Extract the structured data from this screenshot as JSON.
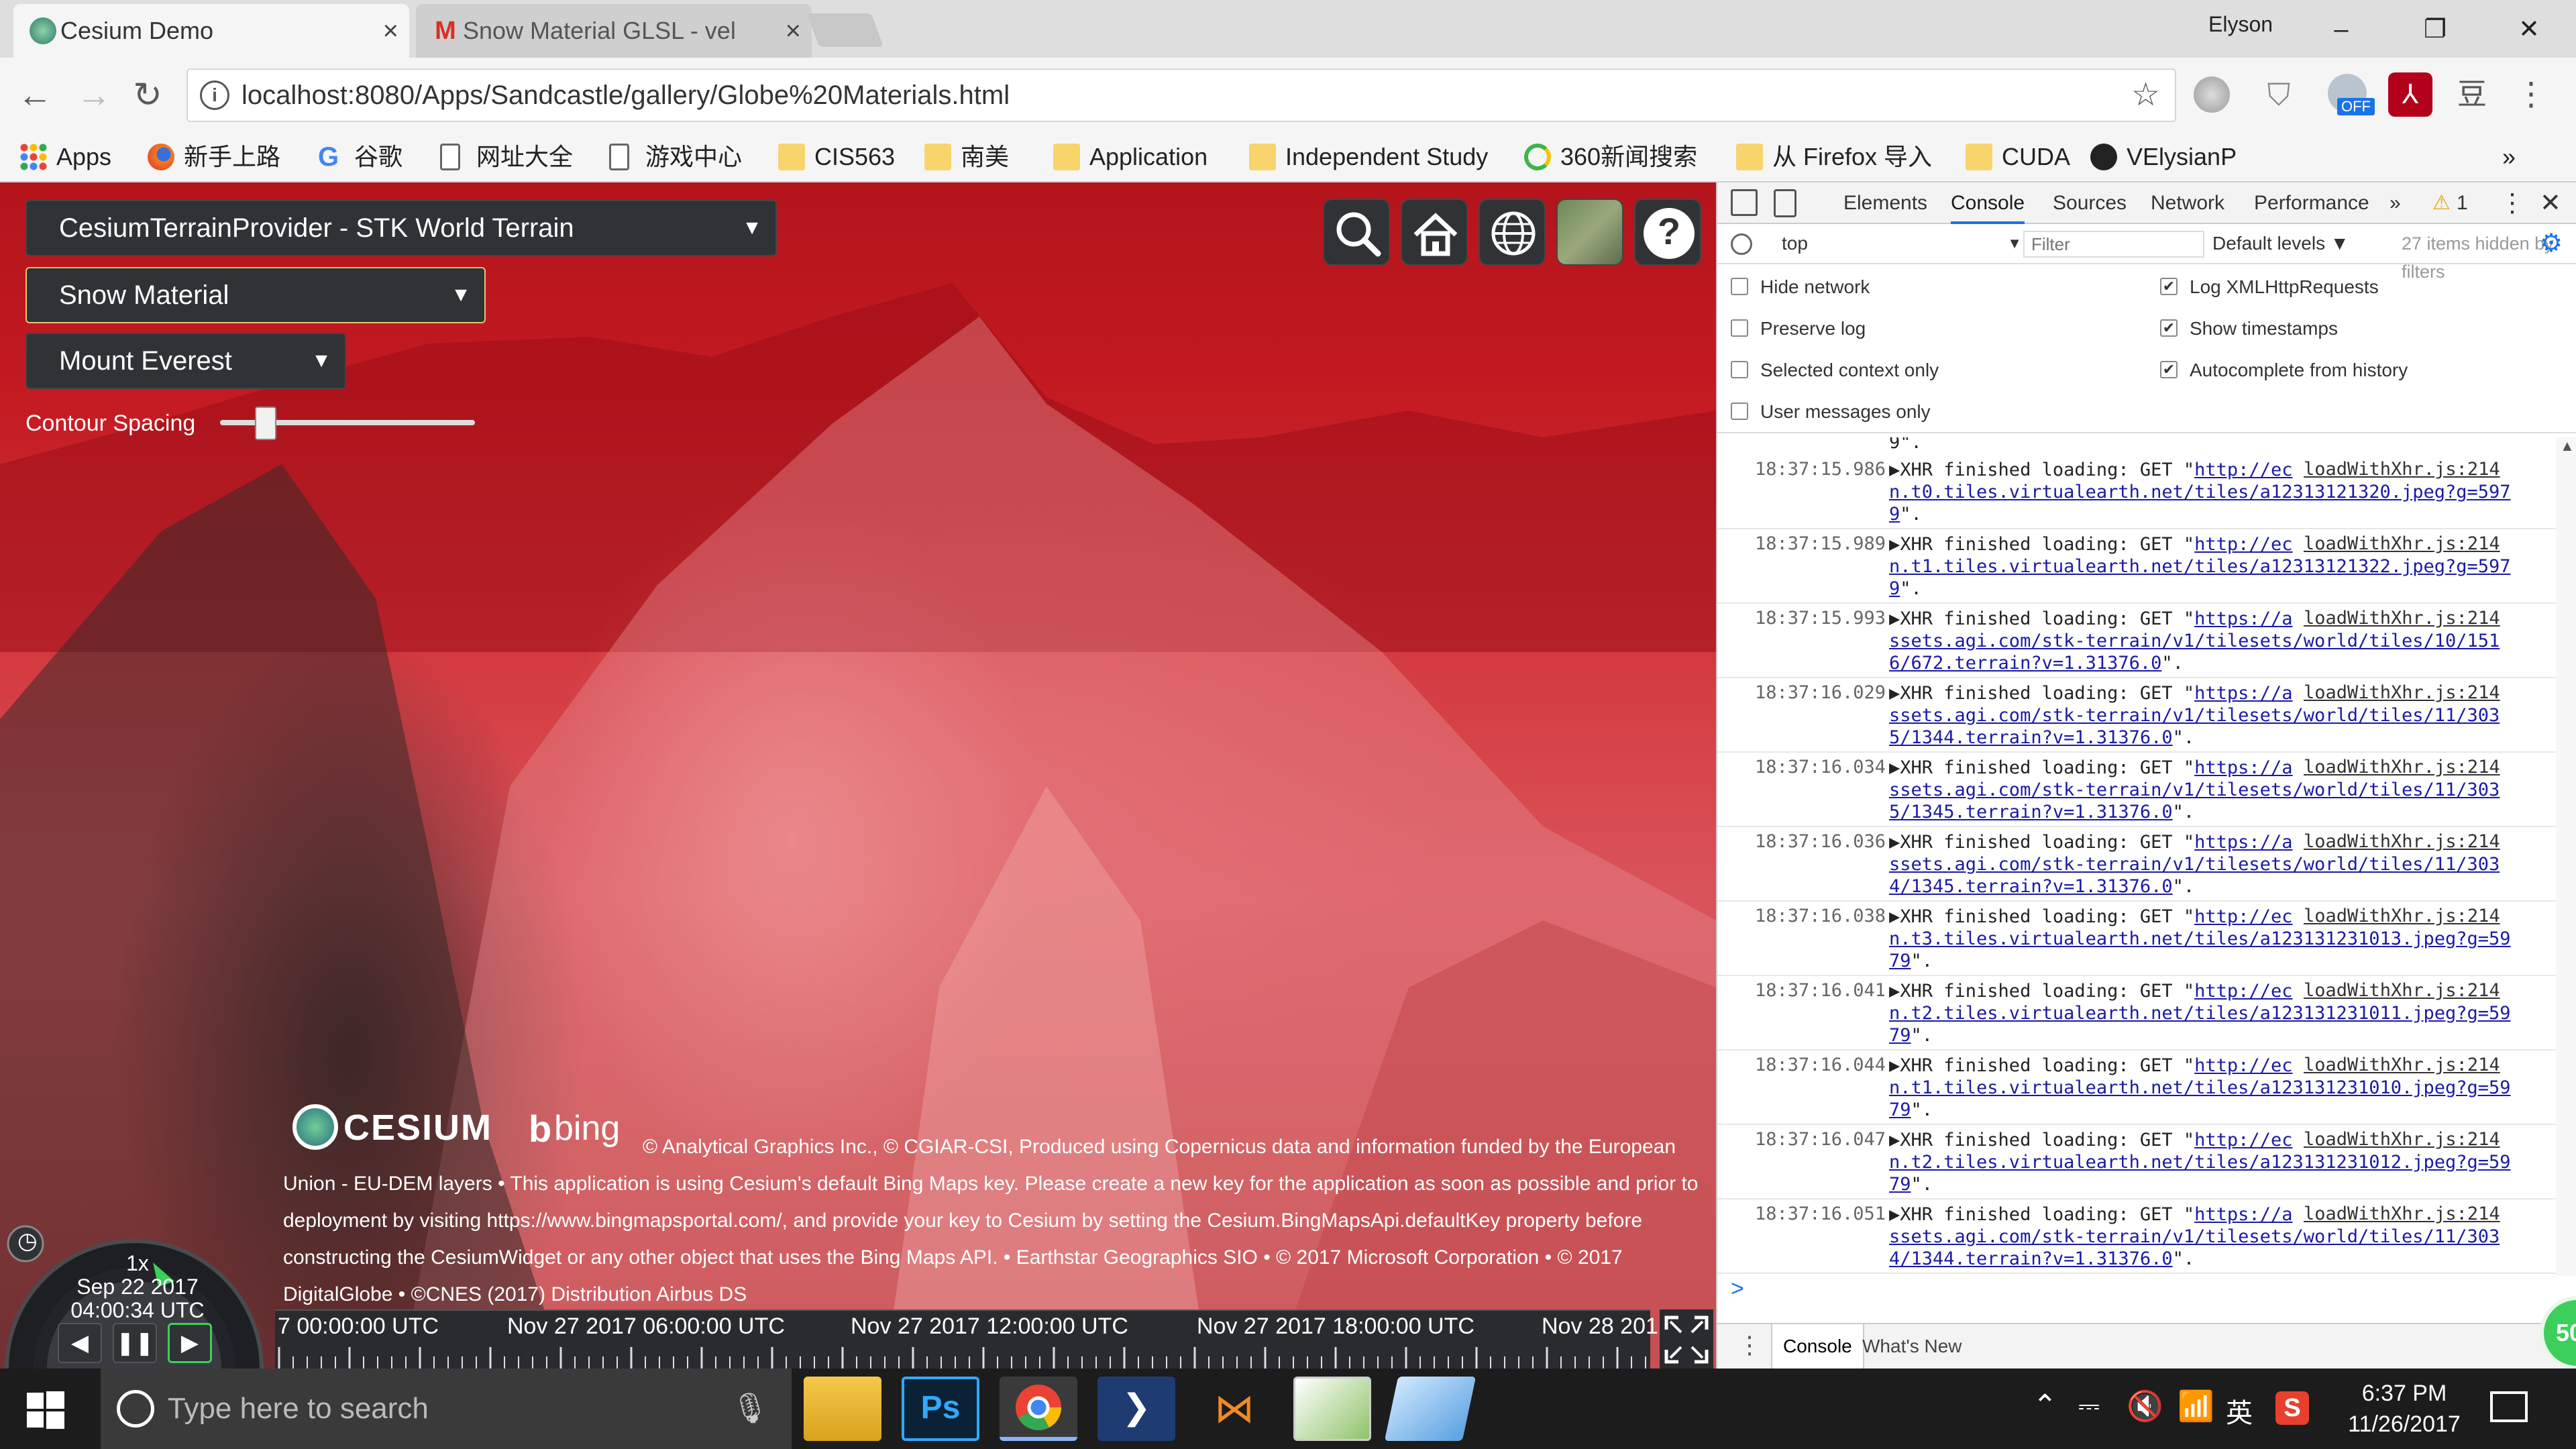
{
  "browser": {
    "tabs": [
      {
        "title": "Cesium Demo",
        "close": "×"
      },
      {
        "title": "Snow Material GLSL - vel",
        "close": "×"
      }
    ],
    "profile_name": "Elyson",
    "window_buttons": {
      "minimize": "–",
      "restore": "❐",
      "close": "✕"
    },
    "url": "localhost:8080/Apps/Sandcastle/gallery/Globe%20Materials.html",
    "nav": {
      "back": "←",
      "forward": "→",
      "reload": "↻"
    },
    "extension_badge": "OFF",
    "bookmarks": [
      {
        "label": "Apps",
        "icon": "apps-grid-icon"
      },
      {
        "label": "新手上路",
        "icon": "firefox-icon"
      },
      {
        "label": "谷歌",
        "icon": "google-icon"
      },
      {
        "label": "网址大全",
        "icon": "page-icon"
      },
      {
        "label": "游戏中心",
        "icon": "page-icon"
      },
      {
        "label": "CIS563",
        "icon": "folder-icon"
      },
      {
        "label": "南美",
        "icon": "folder-icon"
      },
      {
        "label": "Application",
        "icon": "folder-icon"
      },
      {
        "label": "Independent Study",
        "icon": "folder-icon"
      },
      {
        "label": "360新闻搜索",
        "icon": "360-icon"
      },
      {
        "label": "从 Firefox 导入",
        "icon": "folder-icon"
      },
      {
        "label": "CUDA",
        "icon": "folder-icon"
      },
      {
        "label": "VElysianP",
        "icon": "github-icon"
      }
    ],
    "bookmarks_more": "»"
  },
  "viewer": {
    "terrain_select": "CesiumTerrainProvider - STK World Terrain",
    "material_select": "Snow Material",
    "location_select": "Mount Everest",
    "slider_label": "Contour Spacing",
    "slider_value": 0.18,
    "help_label": "?",
    "logos": {
      "cesium": "CESIUM",
      "bing": "bing"
    },
    "credits": "© Analytical Graphics Inc., © CGIAR-CSI, Produced using Copernicus data and information funded by the European Union - EU-DEM layers • This application is using Cesium's default Bing Maps key. Please create a new key for the application as soon as possible and prior to deployment by visiting https://www.bingmapsportal.com/, and provide your key to Cesium by setting the Cesium.BingMapsApi.defaultKey property before constructing the CesiumWidget or any other object that uses the Bing Maps API. • Earthstar Geographics SIO • © 2017 Microsoft Corporation • © 2017 DigitalGlobe • ©CNES (2017) Distribution Airbus DS",
    "animation": {
      "speed": "1x",
      "date": "Sep 22 2017",
      "time": "04:00:34 UTC"
    },
    "timeline_labels": [
      "7 00:00:00 UTC",
      "Nov 27 2017 06:00:00 UTC",
      "Nov 27 2017 12:00:00 UTC",
      "Nov 27 2017 18:00:00 UTC",
      "Nov 28 201"
    ]
  },
  "devtools": {
    "tabs": [
      "Elements",
      "Console",
      "Sources",
      "Network",
      "Performance"
    ],
    "more": "»",
    "warning_count": "1",
    "context": "top",
    "filter_placeholder": "Filter",
    "levels": "Default levels",
    "hidden_note": "27 items hidden by filters",
    "options_left": [
      {
        "label": "Hide network",
        "checked": false
      },
      {
        "label": "Preserve log",
        "checked": false
      },
      {
        "label": "Selected context only",
        "checked": false
      },
      {
        "label": "User messages only",
        "checked": false
      }
    ],
    "options_right": [
      {
        "label": "Log XMLHttpRequests",
        "checked": true
      },
      {
        "label": "Show timestamps",
        "checked": true
      },
      {
        "label": "Autocomplete from history",
        "checked": true
      }
    ],
    "log_top_fragment": "9\".",
    "log": [
      {
        "ts": "18:37:15.986",
        "prefix": "▶XHR finished loading: GET \"",
        "url": [
          "http://ec",
          "n.t0.tiles.virtualearth.net/tiles/a12313121320.jpeg?g=597",
          "9"
        ],
        "suffix": "\".",
        "src": "loadWithXhr.js:214"
      },
      {
        "ts": "18:37:15.989",
        "prefix": "▶XHR finished loading: GET \"",
        "url": [
          "http://ec",
          "n.t1.tiles.virtualearth.net/tiles/a12313121322.jpeg?g=597",
          "9"
        ],
        "suffix": "\".",
        "src": "loadWithXhr.js:214"
      },
      {
        "ts": "18:37:15.993",
        "prefix": "▶XHR finished loading: GET \"",
        "url": [
          "https://a",
          "ssets.agi.com/stk-terrain/v1/tilesets/world/tiles/10/151",
          "6/672.terrain?v=1.31376.0"
        ],
        "suffix": "\".",
        "src": "loadWithXhr.js:214"
      },
      {
        "ts": "18:37:16.029",
        "prefix": "▶XHR finished loading: GET \"",
        "url": [
          "https://a",
          "ssets.agi.com/stk-terrain/v1/tilesets/world/tiles/11/303",
          "5/1344.terrain?v=1.31376.0"
        ],
        "suffix": "\".",
        "src": "loadWithXhr.js:214"
      },
      {
        "ts": "18:37:16.034",
        "prefix": "▶XHR finished loading: GET \"",
        "url": [
          "https://a",
          "ssets.agi.com/stk-terrain/v1/tilesets/world/tiles/11/303",
          "5/1345.terrain?v=1.31376.0"
        ],
        "suffix": "\".",
        "src": "loadWithXhr.js:214"
      },
      {
        "ts": "18:37:16.036",
        "prefix": "▶XHR finished loading: GET \"",
        "url": [
          "https://a",
          "ssets.agi.com/stk-terrain/v1/tilesets/world/tiles/11/303",
          "4/1345.terrain?v=1.31376.0"
        ],
        "suffix": "\".",
        "src": "loadWithXhr.js:214"
      },
      {
        "ts": "18:37:16.038",
        "prefix": "▶XHR finished loading: GET \"",
        "url": [
          "http://ec",
          "n.t3.tiles.virtualearth.net/tiles/a123131231013.jpeg?g=59",
          "79"
        ],
        "suffix": "\".",
        "src": "loadWithXhr.js:214"
      },
      {
        "ts": "18:37:16.041",
        "prefix": "▶XHR finished loading: GET \"",
        "url": [
          "http://ec",
          "n.t2.tiles.virtualearth.net/tiles/a123131231011.jpeg?g=59",
          "79"
        ],
        "suffix": "\".",
        "src": "loadWithXhr.js:214"
      },
      {
        "ts": "18:37:16.044",
        "prefix": "▶XHR finished loading: GET \"",
        "url": [
          "http://ec",
          "n.t1.tiles.virtualearth.net/tiles/a123131231010.jpeg?g=59",
          "79"
        ],
        "suffix": "\".",
        "src": "loadWithXhr.js:214"
      },
      {
        "ts": "18:37:16.047",
        "prefix": "▶XHR finished loading: GET \"",
        "url": [
          "http://ec",
          "n.t2.tiles.virtualearth.net/tiles/a123131231012.jpeg?g=59",
          "79"
        ],
        "suffix": "\".",
        "src": "loadWithXhr.js:214"
      },
      {
        "ts": "18:37:16.051",
        "prefix": "▶XHR finished loading: GET \"",
        "url": [
          "https://a",
          "ssets.agi.com/stk-terrain/v1/tilesets/world/tiles/11/303",
          "4/1344.terrain?v=1.31376.0"
        ],
        "suffix": "\".",
        "src": "loadWithXhr.js:214"
      }
    ],
    "prompt": ">",
    "drawer_tabs": [
      "Console",
      "What's New"
    ],
    "drawer_menu": "⋮",
    "corner_badge": "50"
  },
  "taskbar": {
    "search_placeholder": "Type here to search",
    "time": "6:37 PM",
    "date": "11/26/2017",
    "ime": "英"
  }
}
